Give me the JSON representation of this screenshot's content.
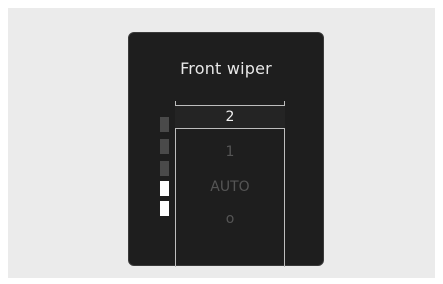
{
  "panel": {
    "title": "Front wiper"
  },
  "wiper_options": [
    {
      "label": "2",
      "selected": true
    },
    {
      "label": "1",
      "selected": false
    },
    {
      "label": "AUTO",
      "selected": false
    },
    {
      "label": "o",
      "selected": false
    }
  ],
  "level_indicator": {
    "segments_total": 5,
    "segments_lit": 2
  },
  "colors": {
    "panel_background": "#1e1e1e",
    "selected_text": "#f0f0f0",
    "dim_text": "#555555",
    "segment_lit": "#ffffff",
    "segment_unlit": "#4a4a4a"
  }
}
